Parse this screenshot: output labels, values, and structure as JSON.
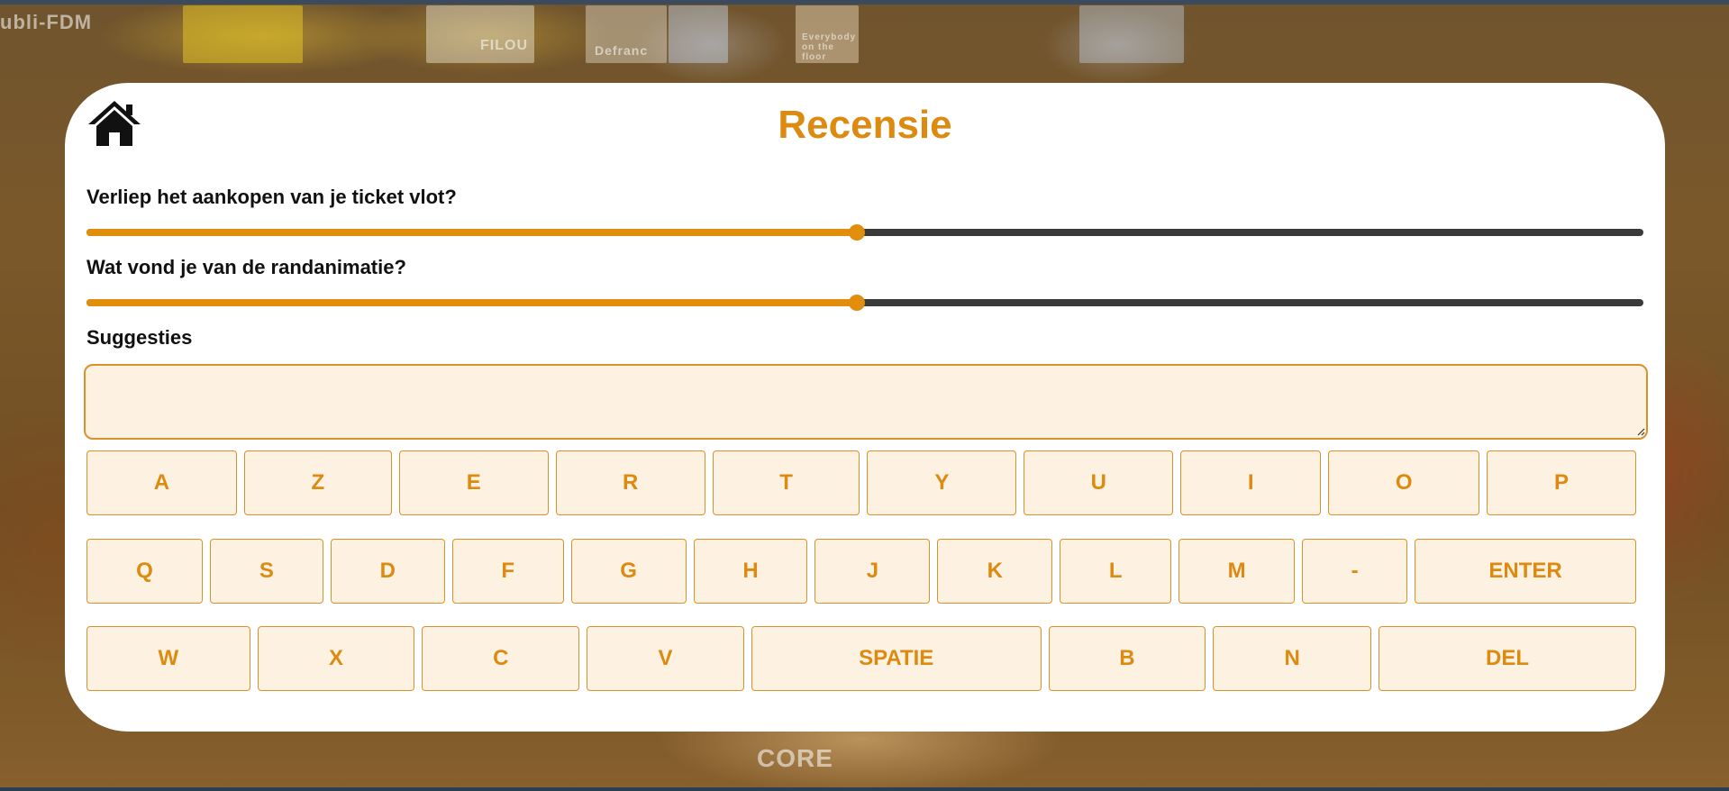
{
  "page": {
    "title": "Recensie"
  },
  "background": {
    "signs": [
      "ubli-FDM",
      "FILOU",
      "Defranc",
      "Everybody on the floor",
      "CORE"
    ]
  },
  "questions": [
    {
      "label": "Verliep het aankopen van je ticket vlot?",
      "value_percent": 49.5
    },
    {
      "label": "Wat vond je van de randanimatie?",
      "value_percent": 49.5
    }
  ],
  "suggestions": {
    "label": "Suggesties",
    "value": "",
    "placeholder": ""
  },
  "keyboard": {
    "row1": [
      "A",
      "Z",
      "E",
      "R",
      "T",
      "Y",
      "U",
      "I",
      "O",
      "P"
    ],
    "row2": [
      "Q",
      "S",
      "D",
      "F",
      "G",
      "H",
      "J",
      "K",
      "L",
      "M",
      "-",
      "ENTER"
    ],
    "row3": [
      "W",
      "X",
      "C",
      "V",
      "SPATIE",
      "B",
      "N",
      "DEL"
    ]
  },
  "colors": {
    "accent": "#e08e0b",
    "title": "#dc8a10",
    "key_background": "#fdf2e2",
    "key_border": "#d9922a",
    "slider_track": "#3a3a3a"
  },
  "icons": {
    "home": "home-icon"
  }
}
